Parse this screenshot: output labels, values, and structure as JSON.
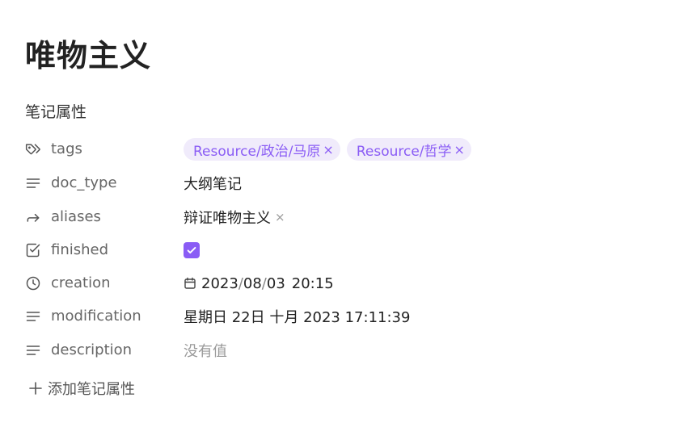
{
  "note": {
    "title": "唯物主义"
  },
  "properties": {
    "heading": "笔记属性",
    "add_label": "添加笔记属性",
    "tags": {
      "key": "tags",
      "icon": "tags-icon",
      "values": [
        "Resource/政治/马原",
        "Resource/哲学"
      ],
      "remove_glyph": "×"
    },
    "doc_type": {
      "key": "doc_type",
      "icon": "text-lines-icon",
      "value": "大纲笔记"
    },
    "aliases": {
      "key": "aliases",
      "icon": "forward-arrow-icon",
      "value": "辩证唯物主义",
      "remove_glyph": "×"
    },
    "finished": {
      "key": "finished",
      "icon": "checkbox-icon",
      "checked": true
    },
    "creation": {
      "key": "creation",
      "icon": "clock-icon",
      "year": "2023",
      "month": "08",
      "day": "03",
      "sep": "/",
      "time": "20:15"
    },
    "modification": {
      "key": "modification",
      "icon": "text-lines-icon",
      "value": "星期日 22日 十月 2023 17:11:39"
    },
    "description": {
      "key": "description",
      "icon": "text-lines-icon",
      "placeholder": "没有值"
    }
  },
  "colors": {
    "accent": "#8a5cf5",
    "tag_bg": "#f0ebfb",
    "label": "#666666",
    "muted": "#999999"
  }
}
